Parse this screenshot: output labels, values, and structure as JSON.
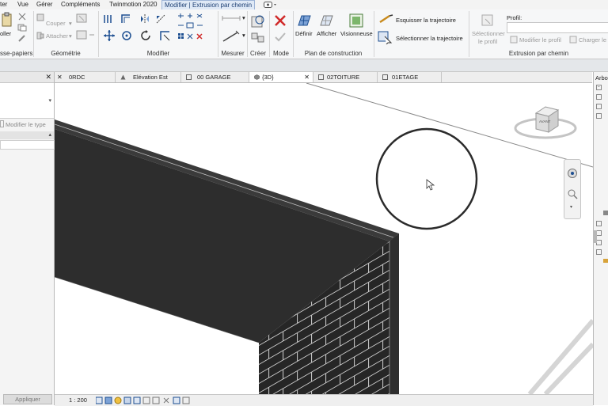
{
  "menubar": {
    "items": [
      "ter",
      "Vue",
      "Gérer",
      "Compléments",
      "Twinmotion 2020",
      "Modifier | Extrusion par chemin"
    ]
  },
  "ribbon": {
    "clipboard": {
      "label_top": "oller",
      "title": "sse-papiers"
    },
    "geometry": {
      "cut": "Couper",
      "join": "Attacher",
      "title": "Géométrie"
    },
    "modify": {
      "title": "Modifier"
    },
    "measure": {
      "title": "Mesurer"
    },
    "create": {
      "title": "Créer"
    },
    "mode": {
      "title": "Mode"
    },
    "workplane": {
      "define": "Définir",
      "show": "Afficher",
      "viewer": "Visionneuse",
      "title": "Plan de construction"
    },
    "path": {
      "sketch": "Esquisser la trajectoire",
      "select": "Sélectionner la trajectoire"
    },
    "sweep": {
      "select_profile_line1": "Sélectionner",
      "select_profile_line2": "le profil",
      "modify_profile": "Modifier le profil",
      "load_profile": "Charger le",
      "profile_label": "Profil:",
      "title": "Extrusion par chemin"
    }
  },
  "left_panel": {
    "edit_type": "Modifier le type",
    "apply": "Appliquer"
  },
  "tabs": [
    {
      "label": "0RDC",
      "active": false
    },
    {
      "label": "Elévation Est",
      "active": false
    },
    {
      "label": "00 GARAGE",
      "active": false
    },
    {
      "label": "{3D}",
      "active": true
    },
    {
      "label": "02TOITURE",
      "active": false
    },
    {
      "label": "01ETAGE",
      "active": false
    }
  ],
  "right_panel": {
    "title": "Arbo"
  },
  "viewcube": {
    "face_label": "AVANT"
  },
  "status": {
    "scale": "1 : 200"
  },
  "colors": {
    "wall": "#2d2d2d",
    "accent": "#1d4f91",
    "close_red": "#d02a2a"
  }
}
